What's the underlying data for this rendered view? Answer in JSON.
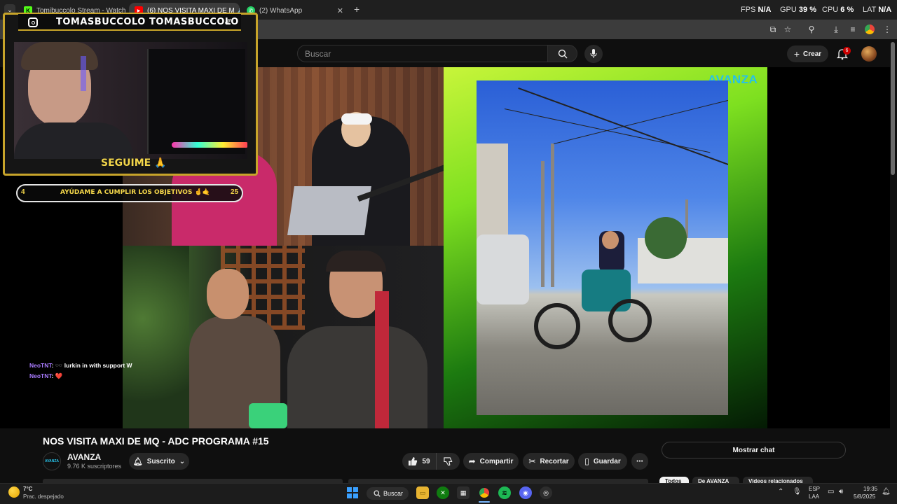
{
  "browser": {
    "tabs": [
      {
        "title": "Tomibuccolo Stream - Watch Li",
        "active": false
      },
      {
        "title": "(6) NOS VISITA MAXI DE M",
        "active": true
      },
      {
        "title": "(2) WhatsApp",
        "active": false
      }
    ],
    "new_tab": "+",
    "stats": {
      "fps_label": "FPS",
      "fps": "N/A",
      "gpu_label": "GPU",
      "gpu": "39 %",
      "cpu_label": "CPU",
      "cpu": "6 %",
      "lat_label": "LAT",
      "lat": "N/A"
    }
  },
  "youtube": {
    "search_placeholder": "Buscar",
    "create_label": "Crear",
    "notifications": "6",
    "video_title": "NOS VISITA MAXI DE MQ - ADC PROGRAMA #15",
    "channel_name": "AVANZA",
    "channel_subs": "9.76 K suscriptores",
    "subscribe_label": "Suscrito",
    "likes": "59",
    "share_label": "Compartir",
    "clip_label": "Recortar",
    "save_label": "Guardar",
    "show_chat_label": "Mostrar chat",
    "chips": [
      "Todos",
      "De AVANZA",
      "Videos relacionados"
    ],
    "channel_logo": "AVANZA"
  },
  "stream_overlay": {
    "name_left": "TOMASBUCCOLO",
    "name_right": "TOMASBUCCOLO",
    "follow_label": "SEGUIME 🙏",
    "goal_start": "4",
    "goal_text": "AYÚDAME A CUMPLIR LOS OBJETIVOS 🤞🤙",
    "goal_end": "25",
    "chat": [
      {
        "user": "NeoTNT",
        "message": ": 🕶️ lurkin in with support W"
      },
      {
        "user": "NeoTNT",
        "message": ": ❤️"
      }
    ]
  },
  "video_panel": {
    "logo": "AVANZA"
  },
  "taskbar": {
    "weather_temp": "7°C",
    "weather_desc": "Prac. despejado",
    "search_label": "Buscar",
    "lang": "ESP",
    "lang_sub": "LAA",
    "time": "19:35",
    "date": "5/8/2025"
  },
  "colors": {
    "overlay_gold": "#c7a42a",
    "yt_bg": "#0f0f0f",
    "accent_red": "#cc0000"
  }
}
